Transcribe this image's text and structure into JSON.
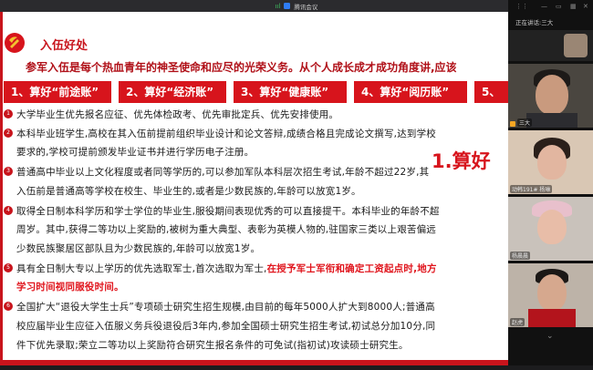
{
  "topbar": {
    "app_name": "腾讯会议",
    "signal": "ııl"
  },
  "slide": {
    "title": "入伍好处",
    "tagline": "参军入伍是每个热血青年的神圣使命和应尽的光荣义务。从个人成长成才成功角度讲,应该",
    "tabs": [
      {
        "label": "1、算好“前途账”"
      },
      {
        "label": "2、算好“经济账”"
      },
      {
        "label": "3、算好“健康账”"
      },
      {
        "label": "4、算好“阅历账”"
      },
      {
        "label": "5、"
      }
    ],
    "big_label": "1.算好",
    "items": [
      {
        "num": "1",
        "lines": [
          "大学毕业生优先报名应征、优先体检政考、优先审批定兵、优先安排使用。"
        ]
      },
      {
        "num": "2",
        "lines": [
          "本科毕业班学生,高校在其入伍前提前组织毕业设计和论文答辩,成绩合格且完成论文撰写,达到学校",
          "要求的,学校可提前颁发毕业证书并进行学历电子注册。"
        ]
      },
      {
        "num": "3",
        "lines": [
          "普通高中毕业以上文化程度或者同等学历的,可以参加军队本科层次招生考试,年龄不超过22岁,其",
          "入伍前是普通高等学校在校生、毕业生的,或者是少数民族的,年龄可以放宽1岁。"
        ]
      },
      {
        "num": "4",
        "lines": [
          "取得全日制本科学历和学士学位的毕业生,服役期间表现优秀的可以直接提干。本科毕业的年龄不超",
          "周岁。其中,获得二等功以上奖励的,被树为重大典型、表彰为英模人物的,驻国家三类以上艰苦偏远",
          "少数民族聚居区部队且为少数民族的,年龄可以放宽1岁。"
        ]
      },
      {
        "num": "5",
        "lines": [
          "具有全日制大专以上学历的优先选取军士,首次选取为军士,",
          "学习时间视同服役时间。"
        ],
        "highlight_a": "在授予军士军衔和确定工资起点时,地方"
      },
      {
        "num": "6",
        "lines": [
          "全国扩大“退役大学生士兵”专项硕士研究生招生规模,由目前的每年5000人扩大到8000人;普通高",
          "校应届毕业生应征入伍服义务兵役退役后3年内,参加全国硕士研究生招生考试,初试总分加10分,同",
          "件下优先录取;荣立二等功以上奖励符合研究生报名条件的可免试(指初试)攻读硕士研究生。"
        ]
      }
    ]
  },
  "panel": {
    "speaking_label": "正在讲话:三大",
    "participants": [
      {
        "name": "三大"
      },
      {
        "name": "动韩191# 杨琳"
      },
      {
        "name": "杨晨晨"
      },
      {
        "name": "赵虎"
      }
    ]
  },
  "colors": {
    "accent_red": "#c8141c",
    "tab_red": "#d7141c"
  }
}
